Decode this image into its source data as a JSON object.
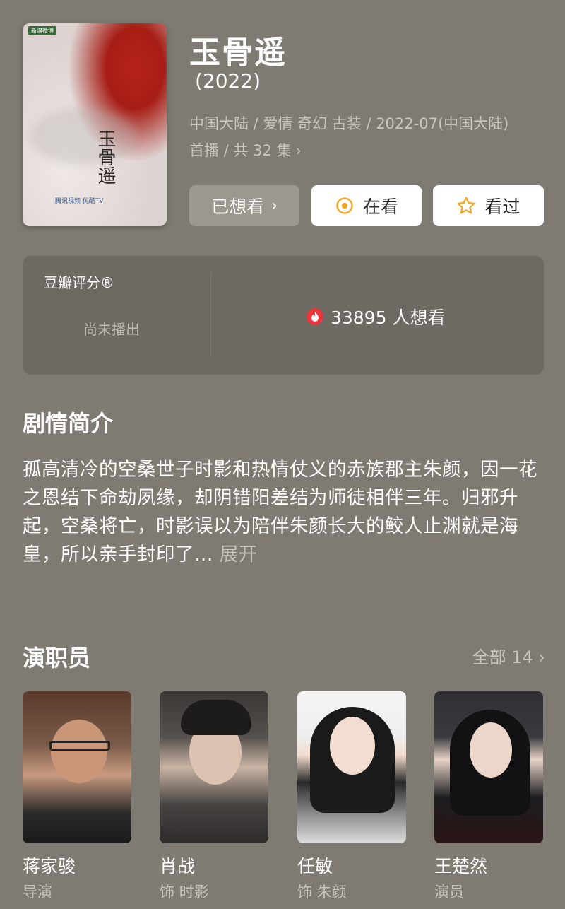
{
  "movie": {
    "title": "玉骨遥",
    "year": "(2022)",
    "meta_line1": "中国大陆 / 爱情 奇幻 古装 / 2022-07(中国大陆)",
    "meta_line2": "首播 / 共 32 集",
    "poster": {
      "badge": "新浪微博",
      "vertical_title": "玉骨遥",
      "platforms": "腾讯视频  优酷TV"
    }
  },
  "actions": {
    "wanted_label": "已想看",
    "watching_label": "在看",
    "watched_label": "看过"
  },
  "rating": {
    "label": "豆瓣评分®",
    "status": "尚未播出",
    "wants_count": "33895 人想看"
  },
  "synopsis": {
    "heading": "剧情简介",
    "text": "孤高清冷的空桑世子时影和热情仗义的赤族郡主朱颜，因一花之恩结下命劫夙缘，却阴错阳差结为师徒相伴三年。归邪升起，空桑将亡，时影误以为陪伴朱颜长大的鲛人止渊就是海皇，所以亲手封印了...",
    "expand_label": "展开"
  },
  "cast": {
    "heading": "演职员",
    "all_label": "全部 14",
    "members": [
      {
        "name": "蒋家骏",
        "role": "导演"
      },
      {
        "name": "肖战",
        "role": "饰 时影"
      },
      {
        "name": "任敏",
        "role": "饰 朱颜"
      },
      {
        "name": "王楚然",
        "role": "演员"
      }
    ]
  },
  "colors": {
    "background": "#7f7a72",
    "card": "#6d6963",
    "accent_orange": "#f5a623",
    "fire_red": "#e8363c"
  }
}
